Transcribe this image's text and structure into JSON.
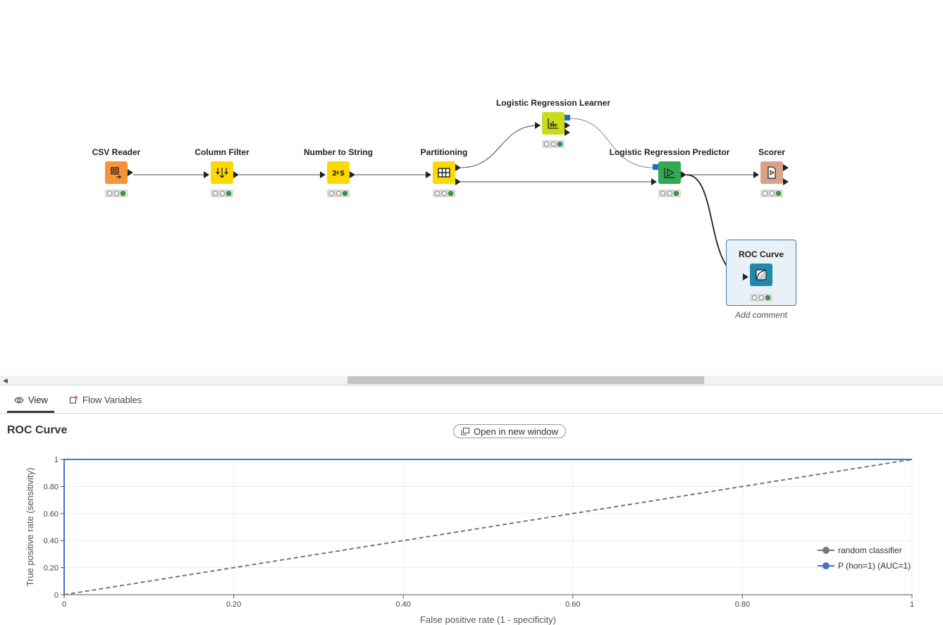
{
  "workflow": {
    "nodes": [
      {
        "id": "csv-reader",
        "title": "CSV Reader",
        "color": "#f7943a",
        "icon": "table-read-icon"
      },
      {
        "id": "column-filter",
        "title": "Column Filter",
        "color": "#fcd902",
        "icon": "filter-icon"
      },
      {
        "id": "number-to-string",
        "title": "Number to String",
        "color": "#fcd902",
        "icon": "convert-icon"
      },
      {
        "id": "partitioning",
        "title": "Partitioning",
        "color": "#fcd902",
        "icon": "grid-icon"
      },
      {
        "id": "lr-learner",
        "title": "Logistic Regression Learner",
        "color": "#c8dc1e",
        "icon": "learner-chart-icon"
      },
      {
        "id": "lr-predictor",
        "title": "Logistic Regression Predictor",
        "color": "#34a853",
        "icon": "predictor-icon"
      },
      {
        "id": "scorer",
        "title": "Scorer",
        "color": "#d8a388",
        "icon": "scorer-icon"
      },
      {
        "id": "roc-curve",
        "title": "ROC Curve",
        "color": "#1f8aad",
        "icon": "roc-icon"
      }
    ],
    "add_comment": "Add comment"
  },
  "tabs": {
    "view": "View",
    "flow_variables": "Flow Variables"
  },
  "view": {
    "title": "ROC Curve",
    "open_new_window": "Open in new window"
  },
  "chart_data": {
    "type": "line",
    "xlabel": "False positive rate (1 - specificity)",
    "ylabel": "True positive rate (sensitivity)",
    "xlim": [
      0,
      1
    ],
    "ylim": [
      0,
      1
    ],
    "xticks": [
      "0",
      "0.20",
      "0.40",
      "0.60",
      "0.80",
      "1"
    ],
    "yticks": [
      "0",
      "0.20",
      "0.40",
      "0.60",
      "0.80",
      "1"
    ],
    "grid": true,
    "legend_position": "bottom-right",
    "series": [
      {
        "name": "random classifier",
        "color": "#777777",
        "dashed": true,
        "x": [
          0,
          1
        ],
        "y": [
          0,
          1
        ]
      },
      {
        "name": "P (hon=1) (AUC=1)",
        "color": "#4e6ecd",
        "dashed": false,
        "x": [
          0,
          0,
          1
        ],
        "y": [
          0,
          1,
          1
        ]
      }
    ]
  }
}
